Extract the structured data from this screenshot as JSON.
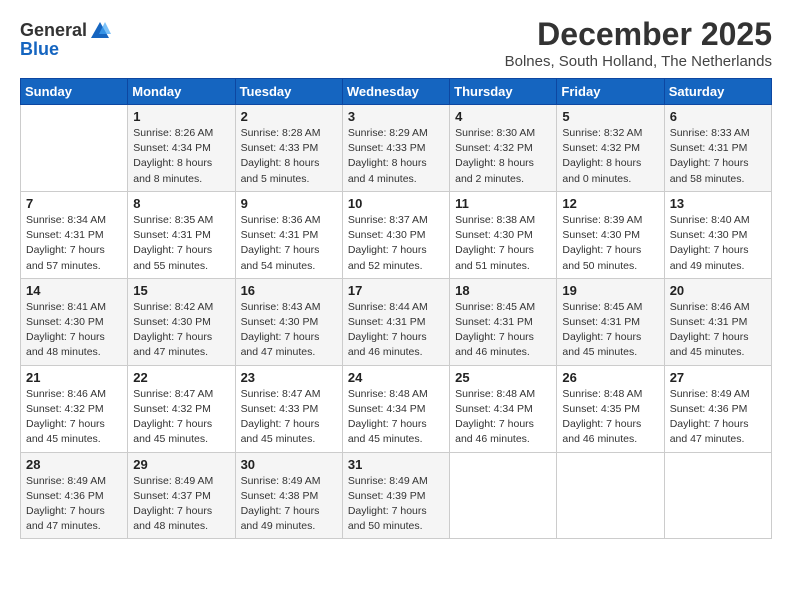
{
  "header": {
    "logo_general": "General",
    "logo_blue": "Blue",
    "month_title": "December 2025",
    "location": "Bolnes, South Holland, The Netherlands"
  },
  "days_of_week": [
    "Sunday",
    "Monday",
    "Tuesday",
    "Wednesday",
    "Thursday",
    "Friday",
    "Saturday"
  ],
  "weeks": [
    [
      {
        "day": "",
        "sunrise": "",
        "sunset": "",
        "daylight": ""
      },
      {
        "day": "1",
        "sunrise": "8:26 AM",
        "sunset": "4:34 PM",
        "daylight": "8 hours and 8 minutes."
      },
      {
        "day": "2",
        "sunrise": "8:28 AM",
        "sunset": "4:33 PM",
        "daylight": "8 hours and 5 minutes."
      },
      {
        "day": "3",
        "sunrise": "8:29 AM",
        "sunset": "4:33 PM",
        "daylight": "8 hours and 4 minutes."
      },
      {
        "day": "4",
        "sunrise": "8:30 AM",
        "sunset": "4:32 PM",
        "daylight": "8 hours and 2 minutes."
      },
      {
        "day": "5",
        "sunrise": "8:32 AM",
        "sunset": "4:32 PM",
        "daylight": "8 hours and 0 minutes."
      },
      {
        "day": "6",
        "sunrise": "8:33 AM",
        "sunset": "4:31 PM",
        "daylight": "7 hours and 58 minutes."
      }
    ],
    [
      {
        "day": "7",
        "sunrise": "8:34 AM",
        "sunset": "4:31 PM",
        "daylight": "7 hours and 57 minutes."
      },
      {
        "day": "8",
        "sunrise": "8:35 AM",
        "sunset": "4:31 PM",
        "daylight": "7 hours and 55 minutes."
      },
      {
        "day": "9",
        "sunrise": "8:36 AM",
        "sunset": "4:31 PM",
        "daylight": "7 hours and 54 minutes."
      },
      {
        "day": "10",
        "sunrise": "8:37 AM",
        "sunset": "4:30 PM",
        "daylight": "7 hours and 52 minutes."
      },
      {
        "day": "11",
        "sunrise": "8:38 AM",
        "sunset": "4:30 PM",
        "daylight": "7 hours and 51 minutes."
      },
      {
        "day": "12",
        "sunrise": "8:39 AM",
        "sunset": "4:30 PM",
        "daylight": "7 hours and 50 minutes."
      },
      {
        "day": "13",
        "sunrise": "8:40 AM",
        "sunset": "4:30 PM",
        "daylight": "7 hours and 49 minutes."
      }
    ],
    [
      {
        "day": "14",
        "sunrise": "8:41 AM",
        "sunset": "4:30 PM",
        "daylight": "7 hours and 48 minutes."
      },
      {
        "day": "15",
        "sunrise": "8:42 AM",
        "sunset": "4:30 PM",
        "daylight": "7 hours and 47 minutes."
      },
      {
        "day": "16",
        "sunrise": "8:43 AM",
        "sunset": "4:30 PM",
        "daylight": "7 hours and 47 minutes."
      },
      {
        "day": "17",
        "sunrise": "8:44 AM",
        "sunset": "4:31 PM",
        "daylight": "7 hours and 46 minutes."
      },
      {
        "day": "18",
        "sunrise": "8:45 AM",
        "sunset": "4:31 PM",
        "daylight": "7 hours and 46 minutes."
      },
      {
        "day": "19",
        "sunrise": "8:45 AM",
        "sunset": "4:31 PM",
        "daylight": "7 hours and 45 minutes."
      },
      {
        "day": "20",
        "sunrise": "8:46 AM",
        "sunset": "4:31 PM",
        "daylight": "7 hours and 45 minutes."
      }
    ],
    [
      {
        "day": "21",
        "sunrise": "8:46 AM",
        "sunset": "4:32 PM",
        "daylight": "7 hours and 45 minutes."
      },
      {
        "day": "22",
        "sunrise": "8:47 AM",
        "sunset": "4:32 PM",
        "daylight": "7 hours and 45 minutes."
      },
      {
        "day": "23",
        "sunrise": "8:47 AM",
        "sunset": "4:33 PM",
        "daylight": "7 hours and 45 minutes."
      },
      {
        "day": "24",
        "sunrise": "8:48 AM",
        "sunset": "4:34 PM",
        "daylight": "7 hours and 45 minutes."
      },
      {
        "day": "25",
        "sunrise": "8:48 AM",
        "sunset": "4:34 PM",
        "daylight": "7 hours and 46 minutes."
      },
      {
        "day": "26",
        "sunrise": "8:48 AM",
        "sunset": "4:35 PM",
        "daylight": "7 hours and 46 minutes."
      },
      {
        "day": "27",
        "sunrise": "8:49 AM",
        "sunset": "4:36 PM",
        "daylight": "7 hours and 47 minutes."
      }
    ],
    [
      {
        "day": "28",
        "sunrise": "8:49 AM",
        "sunset": "4:36 PM",
        "daylight": "7 hours and 47 minutes."
      },
      {
        "day": "29",
        "sunrise": "8:49 AM",
        "sunset": "4:37 PM",
        "daylight": "7 hours and 48 minutes."
      },
      {
        "day": "30",
        "sunrise": "8:49 AM",
        "sunset": "4:38 PM",
        "daylight": "7 hours and 49 minutes."
      },
      {
        "day": "31",
        "sunrise": "8:49 AM",
        "sunset": "4:39 PM",
        "daylight": "7 hours and 50 minutes."
      },
      {
        "day": "",
        "sunrise": "",
        "sunset": "",
        "daylight": ""
      },
      {
        "day": "",
        "sunrise": "",
        "sunset": "",
        "daylight": ""
      },
      {
        "day": "",
        "sunrise": "",
        "sunset": "",
        "daylight": ""
      }
    ]
  ]
}
